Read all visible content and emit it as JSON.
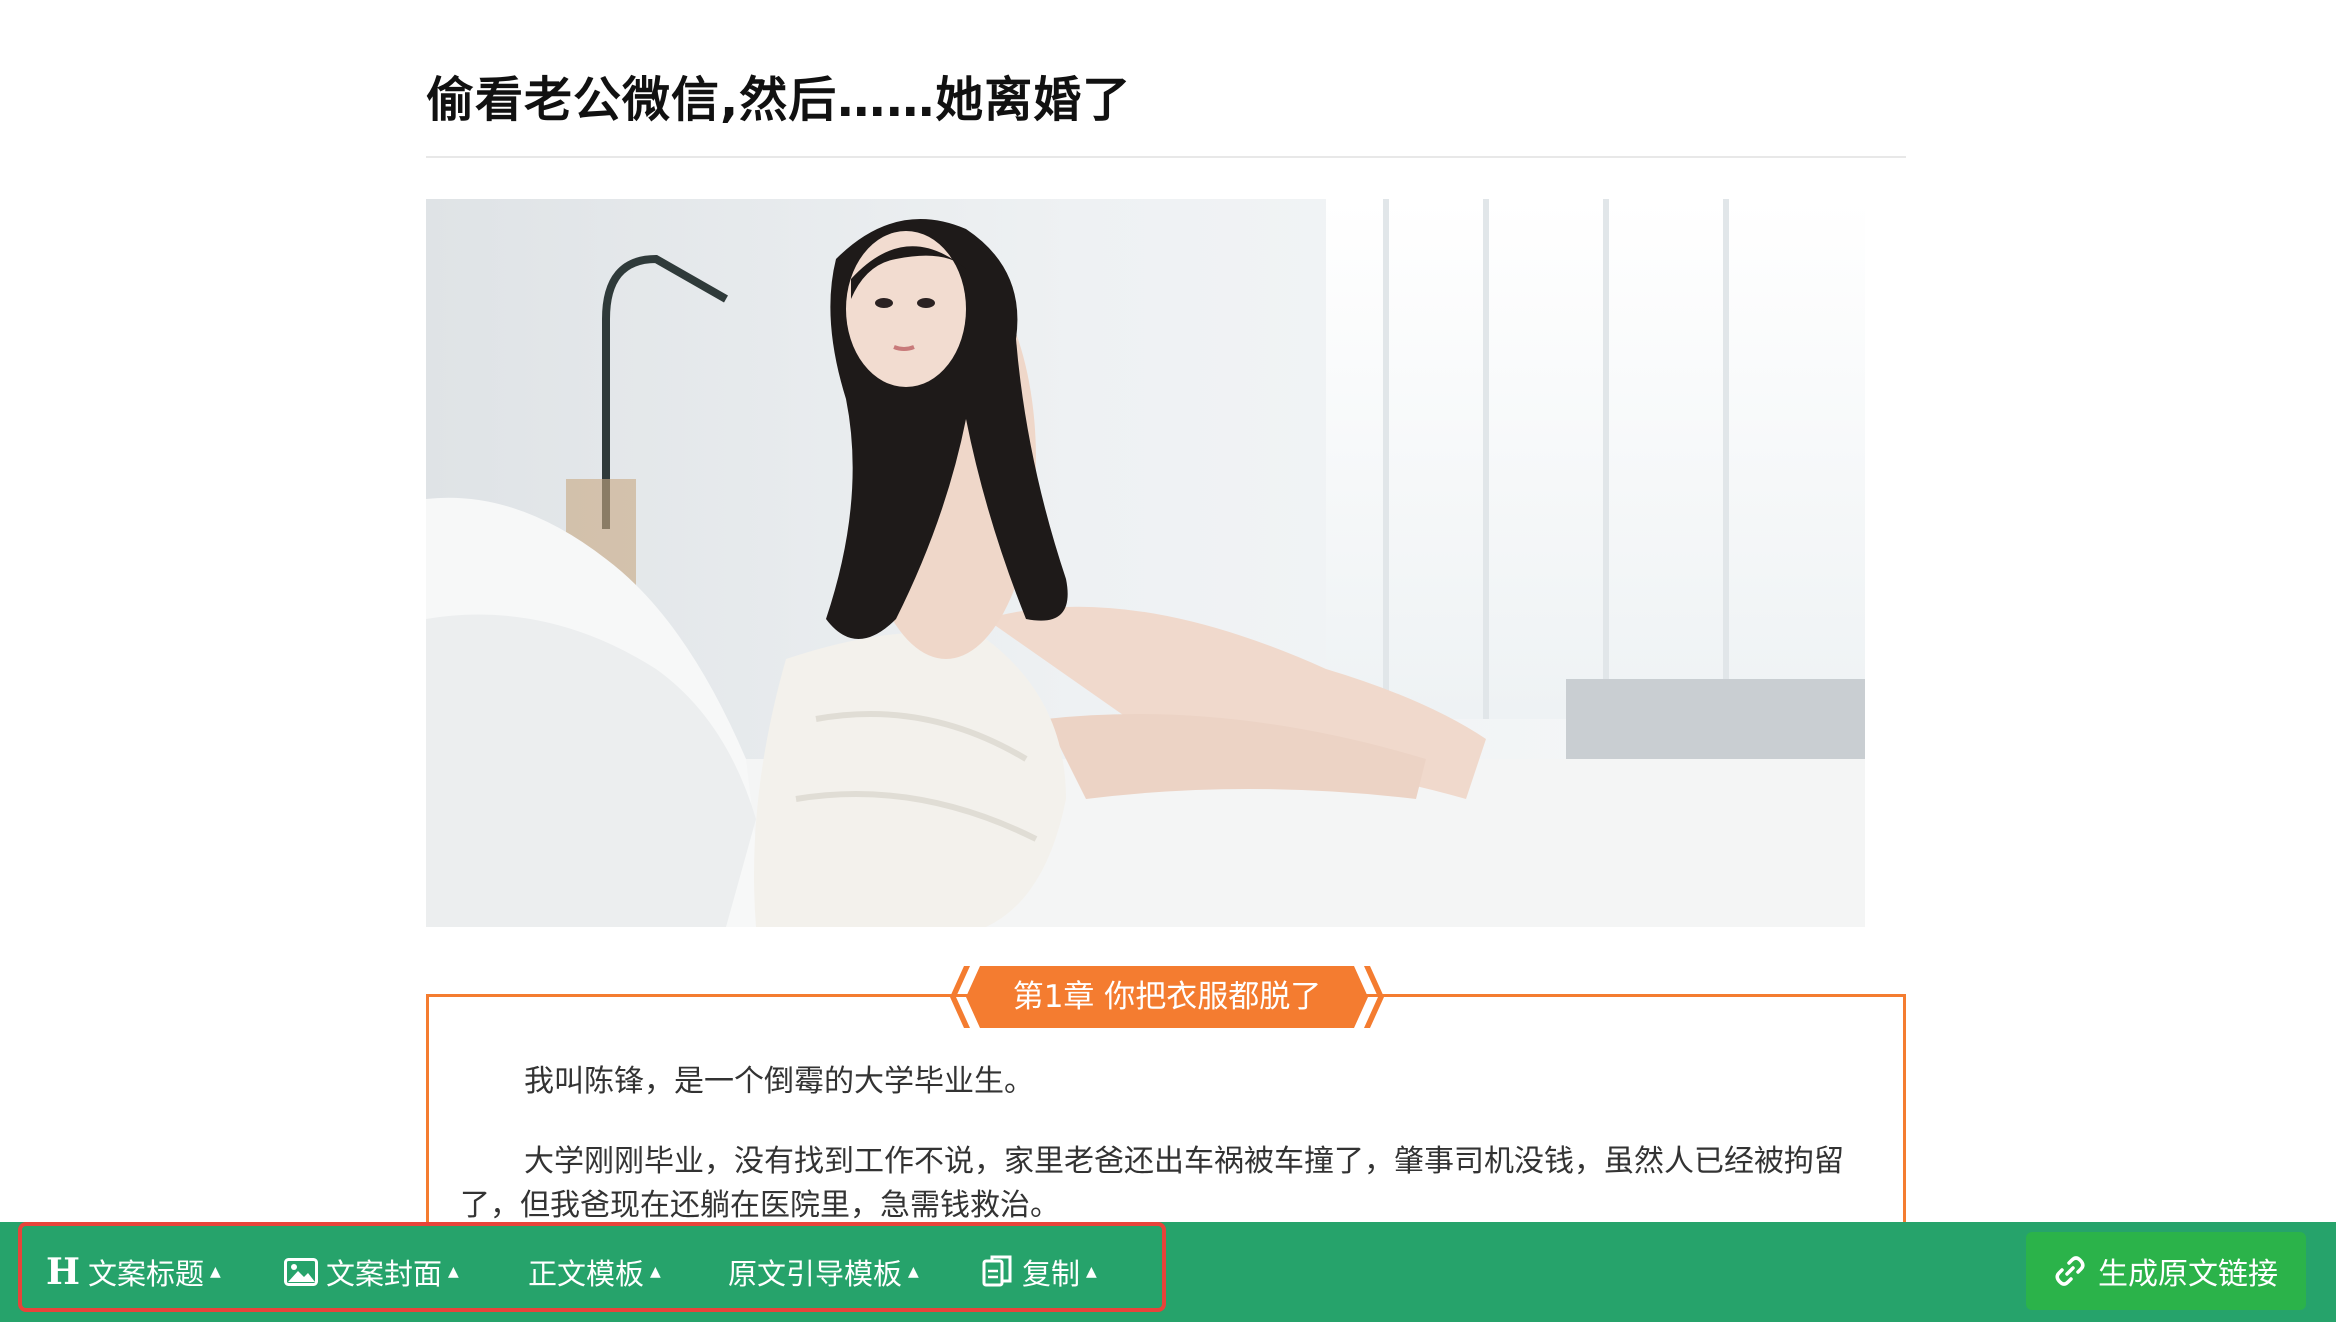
{
  "article": {
    "title": "偷看老公微信,然后……她离婚了",
    "cover_image": "photo of a woman with long black hair in a white knit sweater sitting on a bed",
    "chapter": {
      "label": "第1章 你把衣服都脱了",
      "paragraphs": [
        "我叫陈锋，是一个倒霉的大学毕业生。",
        "大学刚刚毕业，没有找到工作不说，家里老爸还出车祸被车撞了，肇事司机没钱，虽然人已经被拘留了，但我爸现在还躺在医院里，急需钱救治。"
      ]
    }
  },
  "toolbar": {
    "items": [
      {
        "label": "文案标题",
        "icon": "heading-icon"
      },
      {
        "label": "文案封面",
        "icon": "image-icon"
      },
      {
        "label": "正文模板",
        "icon": ""
      },
      {
        "label": "原文引导模板",
        "icon": ""
      },
      {
        "label": "复制",
        "icon": "copy-icon"
      }
    ],
    "generate_link_label": "生成原文链接",
    "colors": {
      "bar": "#26a36b",
      "button": "#2bb34a",
      "highlight": "#e8433a",
      "accent": "#f47c30"
    }
  }
}
